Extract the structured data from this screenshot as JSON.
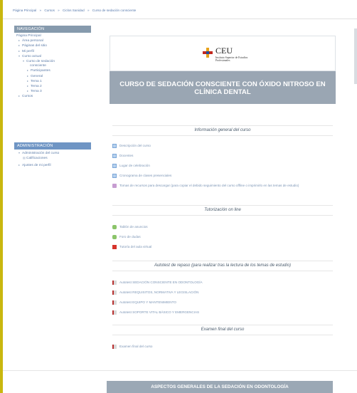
{
  "breadcrumb": [
    "Página Principal",
    "»",
    "Cursos",
    "»",
    "Ciclos Sanidad",
    "»",
    "Curso de sedación consciente"
  ],
  "navigation": {
    "title": "NAVEGACIÓN",
    "items": [
      {
        "label": "Página Principal",
        "level": 0,
        "bullet": ""
      },
      {
        "label": "Área personal",
        "level": 1,
        "bullet": "▸"
      },
      {
        "label": "Páginas del sitio",
        "level": 1,
        "bullet": "▸"
      },
      {
        "label": "Mi perfil",
        "level": 1,
        "bullet": "▸"
      },
      {
        "label": "Curso actual",
        "level": 1,
        "bullet": "▾"
      },
      {
        "label": "Curso de sedación",
        "level": 2,
        "bullet": "▾"
      },
      {
        "label": "consciente",
        "level": 3,
        "bullet": ""
      },
      {
        "label": "Participantes",
        "level": 3,
        "bullet": "▸"
      },
      {
        "label": "General",
        "level": 3,
        "bullet": "▸"
      },
      {
        "label": "Tema 1",
        "level": 3,
        "bullet": "▸"
      },
      {
        "label": "Tema 2",
        "level": 3,
        "bullet": "▸"
      },
      {
        "label": "Tema 3",
        "level": 3,
        "bullet": "▸"
      },
      {
        "label": "Cursos",
        "level": 1,
        "bullet": "▸"
      }
    ]
  },
  "administration": {
    "title": "ADMINISTRACIÓN",
    "items": [
      {
        "label": "Administración del curso",
        "level": 1,
        "bullet": "▾"
      },
      {
        "label": "Calificaciones",
        "level": 2,
        "bullet": "▤"
      },
      {
        "label": "Ajustes de mi perfil",
        "level": 1,
        "bullet": "▸"
      }
    ]
  },
  "banner": {
    "logo_text": "CEU",
    "logo_sub": "Instituto Superior de Estudios Profesionales",
    "title": "CURSO DE SEDACIÓN CONSCIENTE CON ÓXIDO NITROSO EN CLÍNICA DENTAL"
  },
  "section1": {
    "title": "Información general del curso",
    "items": [
      {
        "label": "Descripción del curso",
        "icon": "file-icon"
      },
      {
        "label": "Docentes",
        "icon": "file-icon"
      },
      {
        "label": "Lugar de celebración",
        "icon": "file-icon"
      },
      {
        "label": "Cronograma de clases presenciales",
        "icon": "file-icon"
      }
    ],
    "long_item": "Tomas de recursos para descargar (para copiar el debido seguimiento del curso offline o imprimirlo en las temas de estudio)"
  },
  "section2": {
    "title": "Tutorización on line",
    "items": [
      {
        "label": "Tablón de anuncios",
        "icon": "forum-icon"
      },
      {
        "label": "Foro de dudas",
        "icon": "forum-icon"
      },
      {
        "label": "Tutoría del aula virtual",
        "icon": "book-icon"
      }
    ]
  },
  "section3": {
    "title": "Autotest de repaso (para realizar tras la lectura de los temas de estudio)",
    "items": [
      {
        "label": "Autotest SEDACIÓN CONSCIENTE EN ODONTOLOGÍA",
        "icon": "quiz-icon"
      },
      {
        "label": "Autotest REQUISITOS, NORMATIVA Y LEGISLACIÓN",
        "icon": "quiz-icon"
      },
      {
        "label": "Autotest EQUIPO Y MANTENIMIENTO",
        "icon": "quiz-icon"
      },
      {
        "label": "Autotest SOPORTE VITAL BÁSICO Y EMERGENCIAS",
        "icon": "quiz-icon"
      }
    ]
  },
  "section4": {
    "title": "Examen final del curso",
    "items": [
      {
        "label": "Examen final del curso",
        "icon": "quiz-icon"
      }
    ]
  },
  "banner2": {
    "title": "ASPECTOS GENERALES DE LA SEDACIÓN EN ODONTOLOGÍA"
  },
  "colors": {
    "frame": "#c9b70e",
    "nav_header": "#869aad",
    "admin_header": "#6f95c4",
    "banner_bg": "#9aa6b3",
    "link": "#7d96b6"
  }
}
